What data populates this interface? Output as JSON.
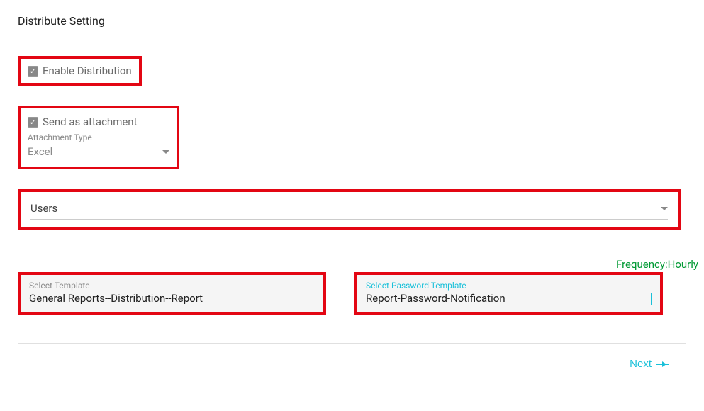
{
  "page_title": "Distribute Setting",
  "enable_distribution": {
    "label": "Enable Distribution",
    "checked": true
  },
  "send_attachment": {
    "label": "Send as attachment",
    "checked": true,
    "type_label": "Attachment Type",
    "type_value": "Excel"
  },
  "users_dropdown": {
    "value": "Users"
  },
  "frequency": {
    "label": "Frequency:",
    "value": "Hourly"
  },
  "template": {
    "label": "Select Template",
    "value": "General Reports--Distribution--Report"
  },
  "password_template": {
    "label": "Select Password Template",
    "value": "Report-Password-Notification"
  },
  "next_label": "Next"
}
